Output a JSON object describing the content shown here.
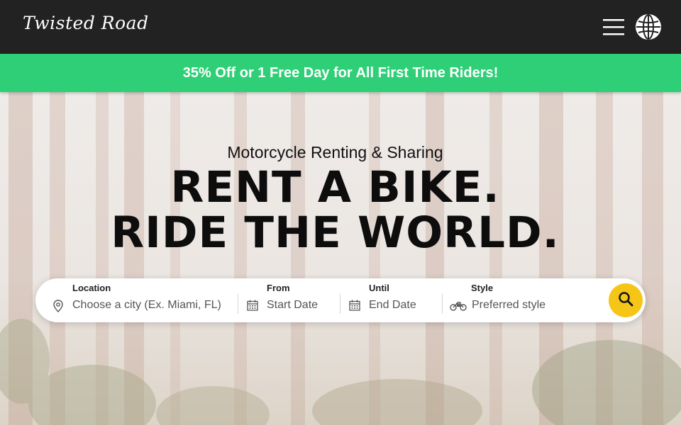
{
  "header": {
    "logo_text": "Twisted Road",
    "menu_icon": "hamburger-menu-icon",
    "language_icon": "globe-icon"
  },
  "promo": {
    "text": "35% Off or 1 Free Day for All First Time Riders!",
    "color": "#2ecf76"
  },
  "hero": {
    "subtitle": "Motorcycle Renting & Sharing",
    "headline_line1": "RENT A BIKE.",
    "headline_line2": "RIDE THE WORLD."
  },
  "search": {
    "location": {
      "label": "Location",
      "placeholder": "Choose a city (Ex. Miami, FL)",
      "icon": "map-pin-icon"
    },
    "from": {
      "label": "From",
      "placeholder": "Start Date",
      "icon": "calendar-icon"
    },
    "until": {
      "label": "Until",
      "placeholder": "End Date",
      "icon": "calendar-icon"
    },
    "style": {
      "label": "Style",
      "placeholder": "Preferred style",
      "icon": "motorcycle-icon"
    },
    "button_icon": "search-icon",
    "button_color": "#f5c518"
  },
  "colors": {
    "header_bg": "#222222",
    "accent_green": "#2ecf76",
    "accent_yellow": "#f5c518"
  }
}
